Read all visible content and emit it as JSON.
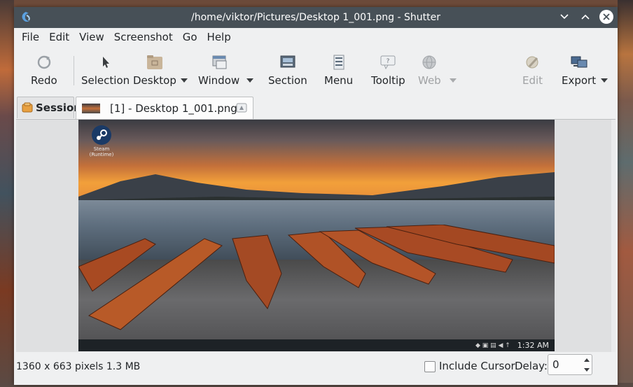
{
  "window": {
    "title": "/home/viktor/Pictures/Desktop 1_001.png - Shutter"
  },
  "menubar": {
    "items": [
      "File",
      "Edit",
      "View",
      "Screenshot",
      "Go",
      "Help"
    ]
  },
  "toolbar": {
    "redo": "Redo",
    "selection": "Selection",
    "desktop": "Desktop",
    "window": "Window",
    "section": "Section",
    "menu": "Menu",
    "tooltip": "Tooltip",
    "web": "Web",
    "edit": "Edit",
    "export": "Export"
  },
  "tabs": {
    "session": "Session",
    "file": "[1] - Desktop 1_001.png"
  },
  "screenshot": {
    "steam_label": "Steam (Runtime)",
    "clock": "1:32 AM"
  },
  "statusbar": {
    "info": "1360 x 663 pixels  1.3 MB",
    "include_cursor": "Include Cursor",
    "include_cursor_checked": false,
    "delay_label": "Delay:",
    "delay_value": "0"
  },
  "colors": {
    "titlebar": "#475057",
    "window_bg": "#eff0f1",
    "disabled_text": "#a0a2a4"
  }
}
